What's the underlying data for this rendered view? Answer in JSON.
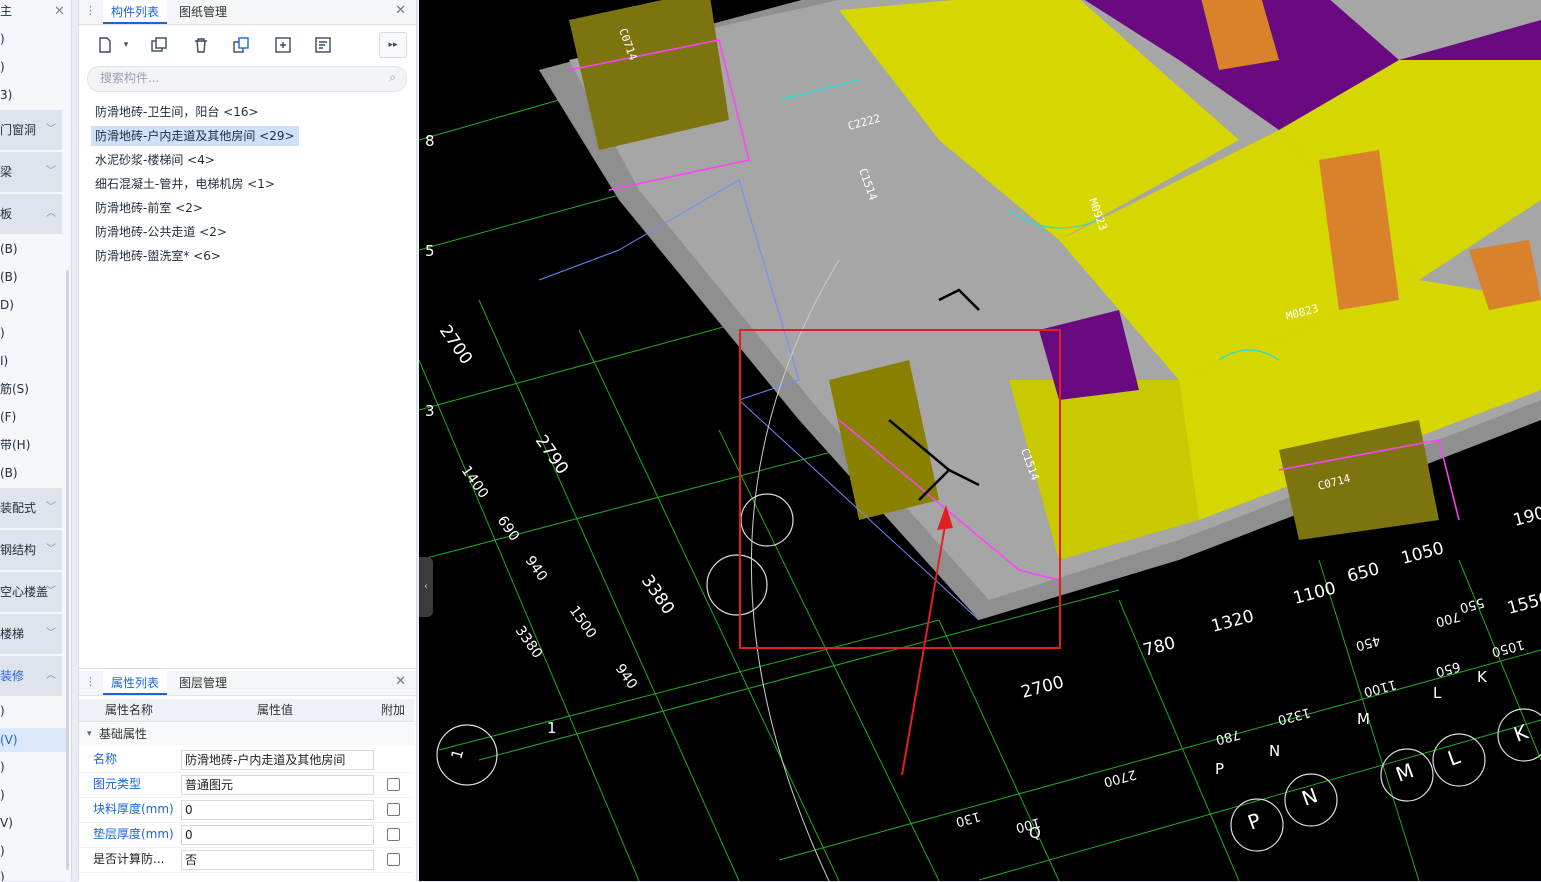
{
  "left_nav": {
    "top_items": [
      "主",
      ")",
      ")",
      "3)"
    ],
    "sections": [
      {
        "label": "门窗洞"
      },
      {
        "label": "梁"
      },
      {
        "label": "板"
      }
    ],
    "items_after_board": [
      "(B)",
      "(B)",
      "D)",
      ")",
      "I)",
      "筋(S)",
      "(F)",
      "带(H)",
      "(B)"
    ],
    "sections2": [
      {
        "label": "装配式"
      },
      {
        "label": "钢结构"
      },
      {
        "label": "空心楼盖"
      },
      {
        "label": "楼梯"
      },
      {
        "label": "装修"
      }
    ],
    "items_after_decor": [
      ")",
      "(V)",
      ")",
      ")",
      "V)",
      ")",
      ")"
    ],
    "selected_item": "(V)"
  },
  "component_panel": {
    "tabs": [
      {
        "label": "构件列表",
        "active": true
      },
      {
        "label": "图纸管理",
        "active": false
      }
    ],
    "search_placeholder": "搜索构件...",
    "items": [
      {
        "label": "防滑地砖-卫生间，阳台 <16>",
        "selected": false
      },
      {
        "label": "防滑地砖-户内走道及其他房间 <29>",
        "selected": true
      },
      {
        "label": "水泥砂浆-楼梯间 <4>",
        "selected": false
      },
      {
        "label": "细石混凝土-管井，电梯机房 <1>",
        "selected": false
      },
      {
        "label": "防滑地砖-前室 <2>",
        "selected": false
      },
      {
        "label": "防滑地砖-公共走道 <2>",
        "selected": false
      },
      {
        "label": "防滑地砖-盥洗室* <6>",
        "selected": false
      }
    ]
  },
  "property_panel": {
    "tabs": [
      {
        "label": "属性列表",
        "active": true
      },
      {
        "label": "图层管理",
        "active": false
      }
    ],
    "columns": [
      "属性名称",
      "属性值",
      "附加"
    ],
    "group": "基础属性",
    "rows": [
      {
        "name": "名称",
        "value": "防滑地砖-户内走道及其他房间",
        "blue": true,
        "checkbox": false
      },
      {
        "name": "图元类型",
        "value": "普通图元",
        "blue": true,
        "checkbox": true
      },
      {
        "name": "块料厚度(mm)",
        "value": "0",
        "blue": true,
        "checkbox": true
      },
      {
        "name": "垫层厚度(mm)",
        "value": "0",
        "blue": true,
        "checkbox": true
      },
      {
        "name": "是否计算防...",
        "value": "否",
        "blue": false,
        "checkbox": true
      }
    ]
  },
  "viewport": {
    "dimension_labels": [
      "2700",
      "2790",
      "3380",
      "1400",
      "690",
      "940",
      "1500",
      "3380",
      "940",
      "2700",
      "780",
      "1320",
      "1100",
      "650",
      "1050",
      "190",
      "1550",
      "550",
      "700",
      "450",
      "1050",
      "1100",
      "650",
      "1320",
      "780",
      "2700",
      "130",
      "100"
    ],
    "axis_labels": [
      "8",
      "5",
      "3",
      "1",
      "1",
      "P",
      "N",
      "M",
      "L",
      "K",
      "P",
      "N",
      "M",
      "L",
      "K",
      "Q"
    ],
    "door_labels": [
      "C0714",
      "C1514",
      "C2222",
      "M0923",
      "M0823",
      "C0714",
      "C1514"
    ],
    "colors": {
      "wall_yellow": "#d6d600",
      "floor_purple": "#6a0a80",
      "column_orange": "#d9822b",
      "slab_gray": "#9a9a9a",
      "highlight_red": "#e02020",
      "grid_green": "#22cc22",
      "accent_magenta": "#ff40ff"
    }
  }
}
